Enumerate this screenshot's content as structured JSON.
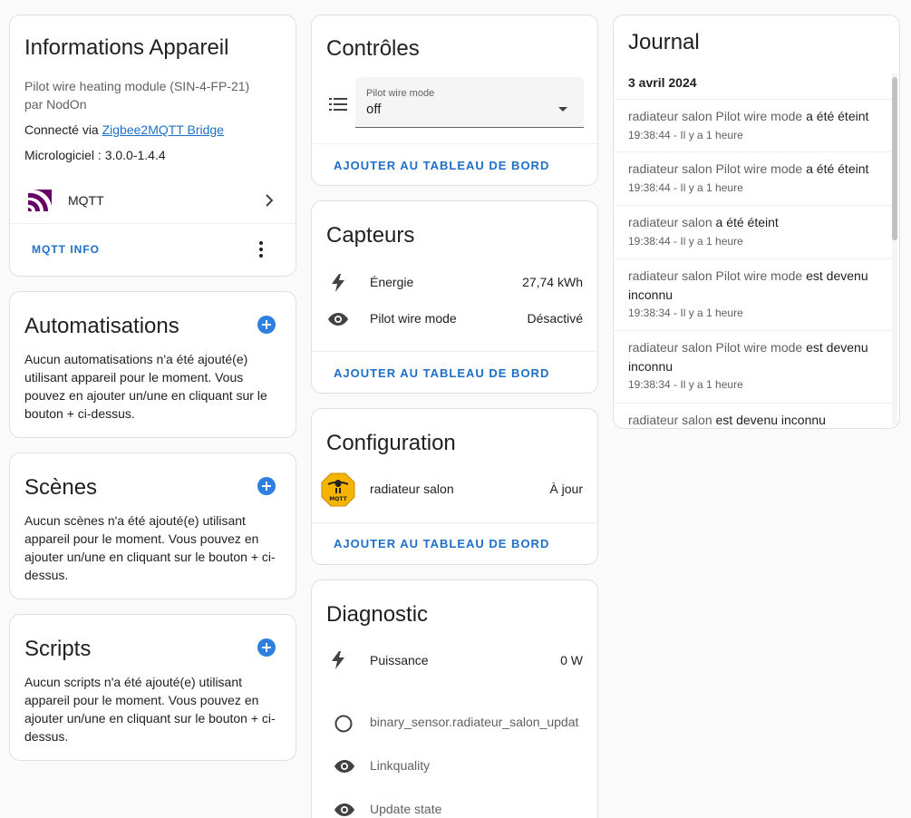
{
  "device_info": {
    "title": "Informations Appareil",
    "model": "Pilot wire heating module (SIN-4-FP-21)",
    "manufacturer": "par NodOn",
    "connected_prefix": "Connecté via ",
    "connected_link": "Zigbee2MQTT Bridge",
    "firmware": "Micrologiciel : 3.0.0-1.4.4",
    "integration": "MQTT",
    "action": "MQTT INFO"
  },
  "automations": {
    "title": "Automatisations",
    "text": "Aucun automatisations n'a été ajouté(e) utilisant appareil pour le moment. Vous pouvez en ajouter un/une en cliquant sur le bouton + ci-dessus."
  },
  "scenes": {
    "title": "Scènes",
    "text": "Aucun scènes n'a été ajouté(e) utilisant appareil pour le moment. Vous pouvez en ajouter un/une en cliquant sur le bouton + ci-dessus."
  },
  "scripts": {
    "title": "Scripts",
    "text": "Aucun scripts n'a été ajouté(e) utilisant appareil pour le moment. Vous pouvez en ajouter un/une en cliquant sur le bouton + ci-dessus."
  },
  "controls": {
    "title": "Contrôles",
    "select_label": "Pilot wire mode",
    "select_value": "off",
    "action": "AJOUTER AU TABLEAU DE BORD"
  },
  "sensors": {
    "title": "Capteurs",
    "rows": [
      {
        "label": "Énergie",
        "value": "27,74 kWh",
        "icon": "lightning-icon"
      },
      {
        "label": "Pilot wire mode",
        "value": "Désactivé",
        "icon": "eye-icon"
      }
    ],
    "action": "AJOUTER AU TABLEAU DE BORD"
  },
  "configuration": {
    "title": "Configuration",
    "row_label": "radiateur salon",
    "row_value": "À jour",
    "action": "AJOUTER AU TABLEAU DE BORD"
  },
  "diagnostic": {
    "title": "Diagnostic",
    "rows": [
      {
        "label": "Puissance",
        "value": "0 W",
        "icon": "lightning-icon"
      },
      {
        "label": "binary_sensor.radiateur_salon_updat",
        "value": "",
        "icon": "circle-icon"
      },
      {
        "label": "Linkquality",
        "value": "",
        "icon": "eye-icon"
      },
      {
        "label": "Update state",
        "value": "",
        "icon": "eye-icon"
      }
    ]
  },
  "journal": {
    "title": "Journal",
    "date": "3 avril 2024",
    "entries": [
      {
        "entity": "radiateur salon Pilot wire mode",
        "action": "a été éteint",
        "time": "19:38:44 - Il y a 1 heure"
      },
      {
        "entity": "radiateur salon Pilot wire mode",
        "action": "a été éteint",
        "time": "19:38:44 - Il y a 1 heure"
      },
      {
        "entity": "radiateur salon",
        "action": "a été éteint",
        "time": "19:38:44 - Il y a 1 heure"
      },
      {
        "entity": "radiateur salon Pilot wire mode",
        "action": "est devenu inconnu",
        "time": "19:38:34 - Il y a 1 heure"
      },
      {
        "entity": "radiateur salon Pilot wire mode",
        "action": "est devenu inconnu",
        "time": "19:38:34 - Il y a 1 heure"
      },
      {
        "entity": "radiateur salon",
        "action": "est devenu inconnu",
        "time": ""
      }
    ]
  }
}
